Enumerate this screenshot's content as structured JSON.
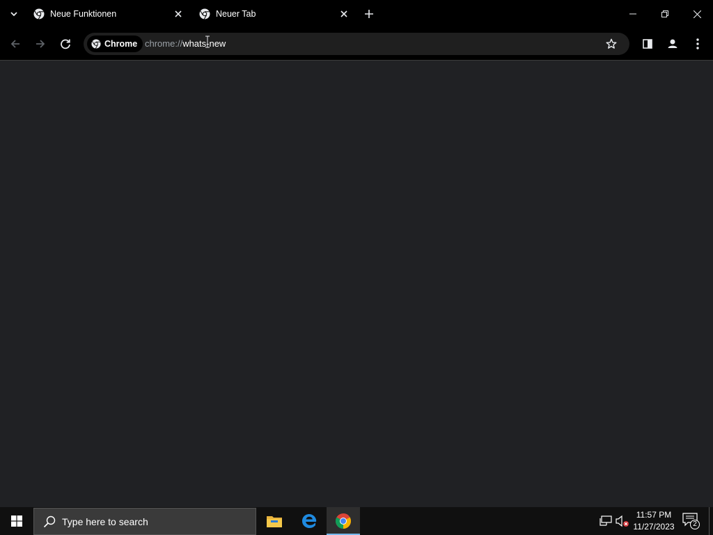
{
  "tabs": [
    {
      "title": "Neue Funktionen",
      "active": true
    },
    {
      "title": "Neuer Tab",
      "active": false
    }
  ],
  "omnibox": {
    "chip_label": "Chrome",
    "url_scheme": "chrome://",
    "url_path": "whats-new"
  },
  "taskbar": {
    "search_placeholder": "Type here to search",
    "time": "11:57 PM",
    "date": "11/27/2023",
    "notification_count": "2"
  },
  "colors": {
    "page_background": "#202124",
    "frame": "#000000",
    "taskbar": "#101010",
    "accent": "#76b9ed"
  },
  "icons": {
    "tab_search": "chevron-down-icon",
    "tab_favicon": "chrome-icon",
    "tab_close": "close-icon",
    "new_tab": "plus-icon",
    "back": "arrow-left-icon",
    "forward": "arrow-right-icon",
    "reload": "reload-icon",
    "bookmark": "star-icon",
    "side_panel": "side-panel-icon",
    "profile": "profile-icon",
    "menu": "kebab-menu-icon",
    "start": "windows-logo-icon",
    "search": "search-icon",
    "file_explorer": "folder-icon",
    "edge": "edge-icon",
    "chrome_app": "chrome-icon",
    "network": "network-icon",
    "volume": "volume-muted-icon",
    "notifications": "notification-icon"
  }
}
